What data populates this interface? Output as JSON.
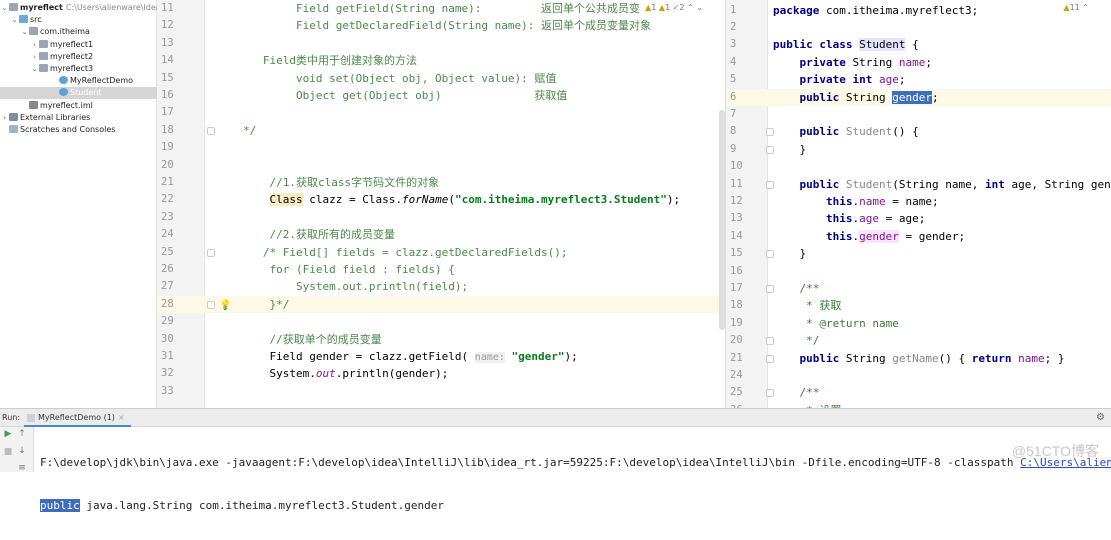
{
  "project": {
    "name": "myreflect",
    "path": "C:\\Users\\alienware\\IdeaProj",
    "tree": [
      {
        "label": "myreflect",
        "arrow": "⌄",
        "icon": "folder",
        "depth": 0,
        "bold": true
      },
      {
        "label": "src",
        "arrow": "⌄",
        "icon": "src",
        "depth": 1
      },
      {
        "label": "com.itheima",
        "arrow": "⌄",
        "icon": "folder",
        "depth": 2
      },
      {
        "label": "myreflect1",
        "arrow": "›",
        "icon": "folder",
        "depth": 3
      },
      {
        "label": "myreflect2",
        "arrow": "›",
        "icon": "folder",
        "depth": 3
      },
      {
        "label": "myreflect3",
        "arrow": "⌄",
        "icon": "folder",
        "depth": 3
      },
      {
        "label": "MyReflectDemo",
        "arrow": "",
        "icon": "cls",
        "depth": 5
      },
      {
        "label": "Student",
        "arrow": "",
        "icon": "cls",
        "depth": 5,
        "selected": true
      },
      {
        "label": "myreflect.iml",
        "arrow": "",
        "icon": "file",
        "depth": 2
      },
      {
        "label": "External Libraries",
        "arrow": "›",
        "icon": "lib",
        "depth": 0
      },
      {
        "label": "Scratches and Consoles",
        "arrow": "",
        "icon": "scr",
        "depth": 0
      }
    ]
  },
  "left_editor": {
    "inspection": {
      "warn1": "1",
      "warn2": "1",
      "ok": "2"
    },
    "lines": [
      {
        "n": "11",
        "t": [
          [
            "c",
            "        Field getField(String name):         返回单个公共成员变"
          ]
        ]
      },
      {
        "n": "12",
        "t": [
          [
            "c",
            "        Field getDeclaredField(String name): 返回单个成员变量对象"
          ]
        ]
      },
      {
        "n": "13",
        "t": []
      },
      {
        "n": "14",
        "t": [
          [
            "c",
            "   Field类中用于创建对象的方法"
          ]
        ]
      },
      {
        "n": "15",
        "t": [
          [
            "c",
            "        void set(Object obj, Object value): 赋值"
          ]
        ]
      },
      {
        "n": "16",
        "t": [
          [
            "c",
            "        Object get(Object obj)              获取值"
          ]
        ]
      },
      {
        "n": "17",
        "t": []
      },
      {
        "n": "18",
        "t": [
          [
            "c",
            "*/"
          ]
        ],
        "fold": true
      },
      {
        "n": "19",
        "t": []
      },
      {
        "n": "20",
        "t": []
      },
      {
        "n": "21",
        "t": [
          [
            "c",
            "    //1.获取class字节码文件的对象"
          ]
        ]
      },
      {
        "n": "22",
        "t": [
          [
            "p",
            "    "
          ],
          [
            "cls-hl",
            "Class"
          ],
          [
            "p",
            " clazz = Class."
          ],
          [
            "it",
            "forName"
          ],
          [
            "p",
            "("
          ],
          [
            "s",
            "\"com.itheima.myreflect3.Student\""
          ],
          [
            "p",
            ");"
          ]
        ]
      },
      {
        "n": "23",
        "t": []
      },
      {
        "n": "24",
        "t": [
          [
            "c",
            "    //2.获取所有的成员变量"
          ]
        ]
      },
      {
        "n": "25",
        "t": [
          [
            "c",
            "   /* Field[] fields = clazz.getDeclaredFields();"
          ]
        ],
        "fold": true
      },
      {
        "n": "26",
        "t": [
          [
            "c",
            "    for (Field field : fields) {"
          ]
        ]
      },
      {
        "n": "27",
        "t": [
          [
            "c",
            "        System.out.println(field);"
          ]
        ]
      },
      {
        "n": "28",
        "t": [
          [
            "c",
            "    }*/"
          ]
        ],
        "fold": true,
        "hl": true,
        "bulb": true
      },
      {
        "n": "29",
        "t": []
      },
      {
        "n": "30",
        "t": [
          [
            "c",
            "    //获取单个的成员变量"
          ]
        ]
      },
      {
        "n": "31",
        "t": [
          [
            "p",
            "    Field gender = clazz.getField( "
          ],
          [
            "h",
            "name:"
          ],
          [
            "p",
            " "
          ],
          [
            "s",
            "\"gender\""
          ],
          [
            "p",
            ");"
          ]
        ]
      },
      {
        "n": "32",
        "t": [
          [
            "p",
            "    System."
          ],
          [
            "f it",
            "out"
          ],
          [
            "p",
            ".println(gender);"
          ]
        ]
      },
      {
        "n": "33",
        "t": []
      }
    ]
  },
  "right_editor": {
    "inspection": {
      "warn": "11"
    },
    "lines": [
      {
        "n": "1",
        "t": [
          [
            "k",
            "package"
          ],
          [
            "p",
            " com.itheima.myreflect3;"
          ]
        ]
      },
      {
        "n": "2",
        "t": []
      },
      {
        "n": "3",
        "t": [
          [
            "k",
            "public class"
          ],
          [
            "p",
            " "
          ],
          [
            "ref",
            "Student"
          ],
          [
            "p",
            " {"
          ]
        ]
      },
      {
        "n": "4",
        "t": [
          [
            "p",
            "    "
          ],
          [
            "k",
            "private"
          ],
          [
            "p",
            " String "
          ],
          [
            "f",
            "name"
          ],
          [
            "p",
            ";"
          ]
        ]
      },
      {
        "n": "5",
        "t": [
          [
            "p",
            "    "
          ],
          [
            "k",
            "private int"
          ],
          [
            "p",
            " "
          ],
          [
            "f",
            "age"
          ],
          [
            "p",
            ";"
          ]
        ]
      },
      {
        "n": "6",
        "t": [
          [
            "p",
            "    "
          ],
          [
            "k",
            "public"
          ],
          [
            "p",
            " String "
          ],
          [
            "sel",
            "gender"
          ],
          [
            "p",
            ";"
          ]
        ],
        "hl": true
      },
      {
        "n": "7",
        "t": []
      },
      {
        "n": "8",
        "t": [
          [
            "p",
            "    "
          ],
          [
            "k",
            "public"
          ],
          [
            "p",
            " "
          ],
          [
            "g",
            "Student"
          ],
          [
            "p",
            "() {"
          ]
        ],
        "fold": true
      },
      {
        "n": "9",
        "t": [
          [
            "p",
            "    }"
          ]
        ],
        "fold": true
      },
      {
        "n": "10",
        "t": []
      },
      {
        "n": "11",
        "t": [
          [
            "p",
            "    "
          ],
          [
            "k",
            "public"
          ],
          [
            "p",
            " "
          ],
          [
            "g",
            "Student"
          ],
          [
            "p",
            "(String name, "
          ],
          [
            "k",
            "int"
          ],
          [
            "p",
            " age, String gender"
          ]
        ],
        "fold": true
      },
      {
        "n": "12",
        "t": [
          [
            "p",
            "        "
          ],
          [
            "k",
            "this"
          ],
          [
            "p",
            "."
          ],
          [
            "f",
            "name"
          ],
          [
            "p",
            " = name;"
          ]
        ]
      },
      {
        "n": "13",
        "t": [
          [
            "p",
            "        "
          ],
          [
            "k",
            "this"
          ],
          [
            "p",
            "."
          ],
          [
            "f",
            "age"
          ],
          [
            "p",
            " = age;"
          ]
        ]
      },
      {
        "n": "14",
        "t": [
          [
            "p",
            "        "
          ],
          [
            "k",
            "this"
          ],
          [
            "p",
            "."
          ],
          [
            "f fhl",
            "gender"
          ],
          [
            "p",
            " = gender;"
          ]
        ]
      },
      {
        "n": "15",
        "t": [
          [
            "p",
            "    }"
          ]
        ],
        "fold": true
      },
      {
        "n": "16",
        "t": []
      },
      {
        "n": "17",
        "t": [
          [
            "cg",
            "    /**"
          ]
        ],
        "fold": true
      },
      {
        "n": "18",
        "t": [
          [
            "cg",
            "     * 获取"
          ]
        ]
      },
      {
        "n": "19",
        "t": [
          [
            "cg",
            "     * @return name"
          ]
        ]
      },
      {
        "n": "20",
        "t": [
          [
            "cg",
            "     */"
          ]
        ],
        "fold": true
      },
      {
        "n": "21",
        "t": [
          [
            "p",
            "    "
          ],
          [
            "k",
            "public"
          ],
          [
            "p",
            " String "
          ],
          [
            "g",
            "getName"
          ],
          [
            "p",
            "() { "
          ],
          [
            "k",
            "return"
          ],
          [
            "p",
            " "
          ],
          [
            "f",
            "name"
          ],
          [
            "p",
            "; }"
          ]
        ],
        "fold": true
      },
      {
        "n": "24",
        "t": []
      },
      {
        "n": "25",
        "t": [
          [
            "cg",
            "    /**"
          ]
        ],
        "fold": true
      },
      {
        "n": "26",
        "t": [
          [
            "cg",
            "     * 设置"
          ]
        ]
      }
    ]
  },
  "run": {
    "label": "Run:",
    "tab": "MyReflectDemo (1)",
    "close": "×",
    "console_line1": "F:\\develop\\jdk\\bin\\java.exe -javaagent:F:\\develop\\idea\\IntelliJ\\lib\\idea_rt.jar=59225:F:\\develop\\idea\\IntelliJ\\bin -Dfile.encoding=UTF-8 -classpath ",
    "console_link": "C:\\Users\\alienware",
    "output_selected": "public",
    "output_rest": " java.lang.String com.itheima.myreflect3.Student.gender"
  },
  "watermark": "@51CTO博客"
}
